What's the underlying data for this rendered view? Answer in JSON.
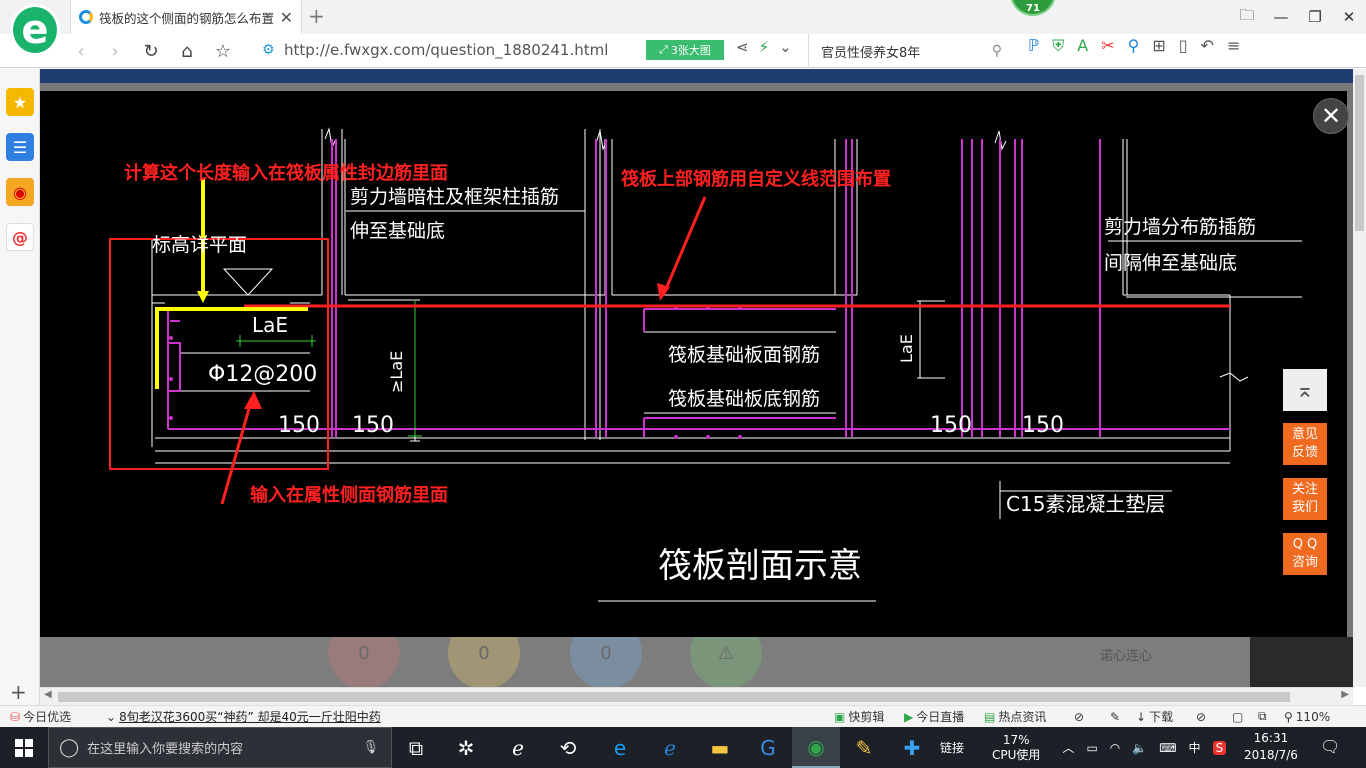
{
  "browser": {
    "tab_title": "筏板的这个侧面的钢筋怎么布置呢",
    "new_tab_symbol": "+",
    "badge_count": "71",
    "url": "http://e.fwxgx.com/question_1880241.html",
    "big_image_button": "3张大图",
    "search_query": "官员性侵养女8年",
    "window_controls": [
      "🗀",
      "—",
      "❐",
      "✕"
    ]
  },
  "sidebar": {
    "items": [
      "favorites-icon",
      "reading-list-icon",
      "weibo-icon",
      "mail-icon"
    ],
    "add": "+"
  },
  "cad": {
    "annot_length": "计算这个长度输入在筏板属性封边筋里面",
    "annot_top_rebar": "筏板上部钢筋用自定义线范围布置",
    "annot_side_rebar": "输入在属性侧面钢筋里面",
    "label_elevation": "标高详平面",
    "label_wall_rebar_1": "剪力墙暗柱及框架柱插筋",
    "label_wall_rebar_2": "伸至基础底",
    "label_dist_rebar_1": "剪力墙分布筋插筋",
    "label_dist_rebar_2": "间隔伸至基础底",
    "label_lae": "LaE",
    "label_rebar_spec": "Φ12@200",
    "label_150": "150",
    "label_lae_vert": "≥LaE",
    "label_lae_vert2": "LaE",
    "label_face_rebar": "筏板基础板面钢筋",
    "label_bottom_rebar": "筏板基础板底钢筋",
    "label_cushion": "C15素混凝土垫层",
    "caption": "筏板剖面示意"
  },
  "under_page": {
    "counts": [
      "0",
      "0",
      "0"
    ],
    "text": "诺心连心"
  },
  "floating": {
    "close": "✕",
    "to_top": "⌅",
    "feedback": [
      "意见",
      "反馈"
    ],
    "follow": [
      "关注",
      "我们"
    ],
    "qq": [
      "Q Q",
      "咨询"
    ]
  },
  "statusbar": {
    "left_label": "今日优选",
    "headline": "8旬老汉花3600买“神药” 却是40元一斤壮阳中药",
    "items": [
      "快剪辑",
      "今日直播",
      "热点资讯"
    ],
    "download": "下载",
    "zoom": "110%"
  },
  "taskbar": {
    "search_placeholder": "在这里输入你要搜索的内容",
    "links": "链接",
    "cpu_percent": "17%",
    "cpu_label": "CPU使用",
    "ime": "中",
    "time": "16:31",
    "date": "2018/7/6"
  },
  "colors": {
    "cad_bg": "#000000",
    "annotation_red": "#ff2020",
    "highlight_yellow": "#ffff00",
    "magenta": "#cc33cc",
    "green": "#33cc33",
    "accent_orange": "#f06a20",
    "browser_green": "#19b36b"
  }
}
